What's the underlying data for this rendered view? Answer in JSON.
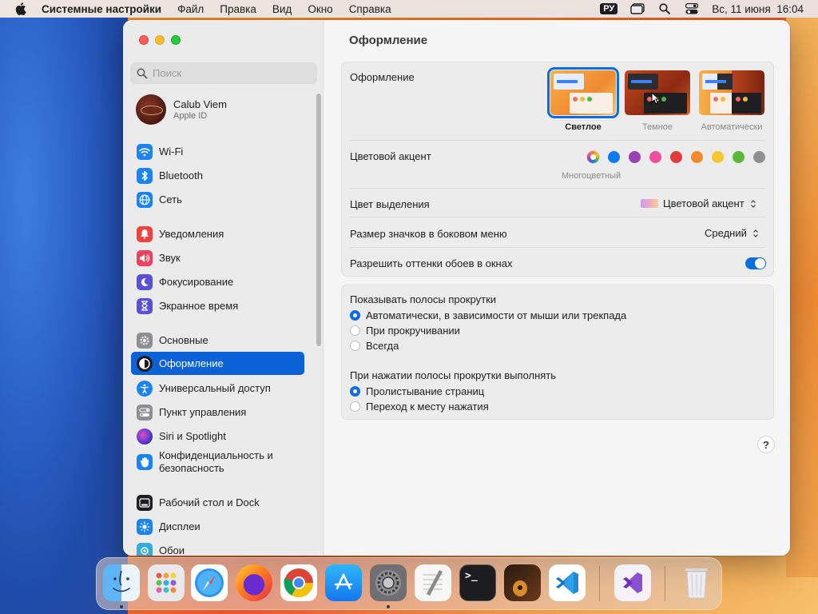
{
  "menubar": {
    "app_name": "Системные настройки",
    "menus": [
      "Файл",
      "Правка",
      "Вид",
      "Окно",
      "Справка"
    ],
    "input_source": "РУ",
    "datetime": "Вс, 11 июня  16:04"
  },
  "sidebar": {
    "search_placeholder": "Поиск",
    "account": {
      "name": "Calub Viem",
      "subtitle": "Apple ID"
    },
    "items": [
      {
        "label": "Wi-Fi",
        "icon": "wifi-icon",
        "color": "#1a84f5"
      },
      {
        "label": "Bluetooth",
        "icon": "bluetooth-icon",
        "color": "#1a84f5"
      },
      {
        "label": "Сеть",
        "icon": "globe-icon",
        "color": "#1a84f5"
      },
      {
        "label": "Уведомления",
        "icon": "bell-icon",
        "color": "#f0423f"
      },
      {
        "label": "Звук",
        "icon": "speaker-icon",
        "color": "#f0425e"
      },
      {
        "label": "Фокусирование",
        "icon": "moon-icon",
        "color": "#5a4fd8"
      },
      {
        "label": "Экранное время",
        "icon": "hourglass-icon",
        "color": "#5a4fd8"
      },
      {
        "label": "Основные",
        "icon": "gear-icon",
        "color": "#8e8e93"
      },
      {
        "label": "Оформление",
        "icon": "appearance-icon",
        "color": "#1d1d1f"
      },
      {
        "label": "Универсальный доступ",
        "icon": "accessibility-icon",
        "color": "#1a84f5"
      },
      {
        "label": "Пункт управления",
        "icon": "control-center-icon",
        "color": "#8e8e93"
      },
      {
        "label": "Siri и Spotlight",
        "icon": "siri-icon",
        "color": "#3a2d6e"
      },
      {
        "label": "Конфиденциальность и безопасность",
        "icon": "hand-icon",
        "color": "#1a84f5"
      },
      {
        "label": "Рабочий стол и Dock",
        "icon": "desktop-dock-icon",
        "color": "#1d1d1f"
      },
      {
        "label": "Дисплеи",
        "icon": "sun-icon",
        "color": "#1a84f5"
      },
      {
        "label": "Обои",
        "icon": "wallpaper-icon",
        "color": "#35aadc"
      }
    ],
    "selected_index": 8
  },
  "main": {
    "title": "Оформление",
    "appearance": {
      "label": "Оформление",
      "options": [
        "Светлое",
        "Темное",
        "Автоматически"
      ],
      "selected": "Светлое"
    },
    "accent": {
      "label": "Цветовой акцент",
      "caption": "Многоцветный",
      "colors": [
        "multicolor",
        "#0a7cf5",
        "#9a3fb5",
        "#ef4e9a",
        "#e23b3b",
        "#f5882a",
        "#f7c62f",
        "#5cb938",
        "#8e8e93"
      ]
    },
    "highlight": {
      "label": "Цвет выделения",
      "value": "Цветовой акцент"
    },
    "sidebar_icon_size": {
      "label": "Размер значков в боковом меню",
      "value": "Средний"
    },
    "wallpaper_tinting": {
      "label": "Разрешить оттенки обоев в окнах",
      "enabled": true
    },
    "scrollbars": {
      "label": "Показывать полосы прокрутки",
      "options": [
        "Автоматически, в зависимости от мыши или трекпада",
        "При прокручивании",
        "Всегда"
      ],
      "selected": 0
    },
    "click_scrollbar": {
      "label": "При нажатии полосы прокрутки выполнять",
      "options": [
        "Пролистывание страниц",
        "Переход к месту нажатия"
      ],
      "selected": 0
    },
    "help": "?"
  },
  "dock": {
    "apps": [
      "Finder",
      "Launchpad",
      "Safari",
      "Firefox",
      "Chrome",
      "App Store",
      "System Settings",
      "TextEdit",
      "Terminal",
      "GarageBand",
      "VS Code",
      "Visual Studio",
      "Trash"
    ],
    "terminal_prompt": ">_"
  }
}
